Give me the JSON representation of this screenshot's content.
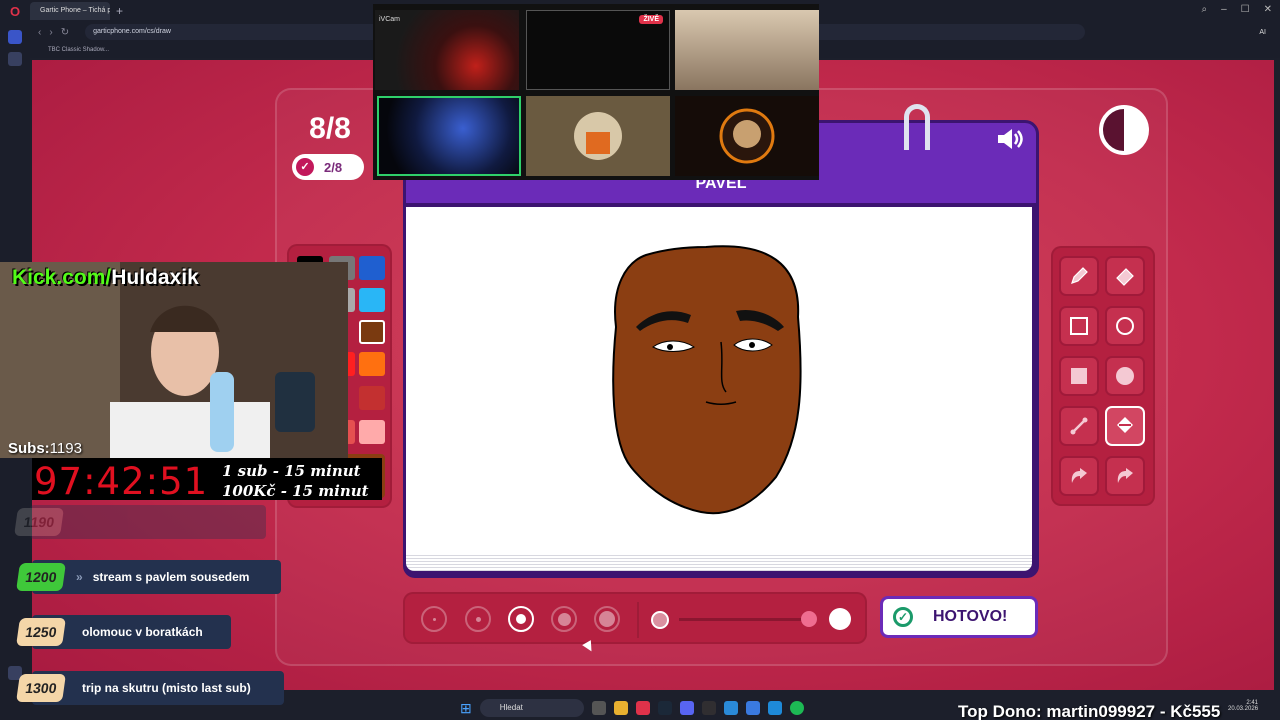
{
  "browser": {
    "tab_title": "Gartic Phone – Tichá pošt",
    "url": "garticphone.com/cs/draw",
    "bookmark": "TBC Classic Shadow..."
  },
  "game": {
    "round": "8/8",
    "done_count": "2/8",
    "player_name": "PAVEL",
    "done_button": "HOTOVO!",
    "brush_size_selected": 3,
    "opacity_level": 0.95
  },
  "palette_colors": [
    "#000000",
    "#777777",
    "#1f5fd0",
    "#ffffff",
    "#aaaaaa",
    "#29b6f6",
    "#7a3a10",
    "#8b1630",
    "#994411",
    "#ff2020",
    "#e81e63",
    "#ff7010",
    "#c33030",
    "#e55050",
    "#d06060",
    "#ffaaaa",
    "#ff8080",
    "#ffb0a0"
  ],
  "selected_color": "#8B3E12",
  "tools": [
    {
      "name": "pen-icon"
    },
    {
      "name": "eraser-icon"
    },
    {
      "name": "rectangle-outline-icon"
    },
    {
      "name": "ellipse-outline-icon"
    },
    {
      "name": "rectangle-filled-icon"
    },
    {
      "name": "ellipse-filled-icon"
    },
    {
      "name": "line-icon"
    },
    {
      "name": "fill-bucket-icon"
    },
    {
      "name": "undo-icon"
    },
    {
      "name": "redo-icon"
    }
  ],
  "cams": {
    "label_ivcam": "iVCam",
    "live_badge": "ŽIVĚ"
  },
  "overlay": {
    "kick_prefix": "Kick.com/",
    "kick_name": "Huldaxik",
    "subs_label": "Subs:",
    "subs_value": "1193",
    "countdown": "97:42:51",
    "rule1": "1 sub - 15 minut",
    "rule2": "100Kč - 15 minut",
    "goals": [
      {
        "n": "1190",
        "text": ""
      },
      {
        "n": "1200",
        "text": "stream s pavlem sousedem"
      },
      {
        "n": "1250",
        "text": "olomouc v boratkách"
      },
      {
        "n": "1300",
        "text": "trip na skutru (misto last sub)"
      }
    ],
    "top_dono": "Top Dono: martin099927 - Kč555"
  },
  "taskbar": {
    "search": "Hledat",
    "time": "2:41",
    "date": "20.03.2026"
  },
  "colors": {
    "bg_red": "#c22a4c",
    "header_purple": "#6b2bb8",
    "face_brown": "#8B3E12",
    "kick_green": "#53fc18",
    "countdown_red": "#e01020"
  }
}
